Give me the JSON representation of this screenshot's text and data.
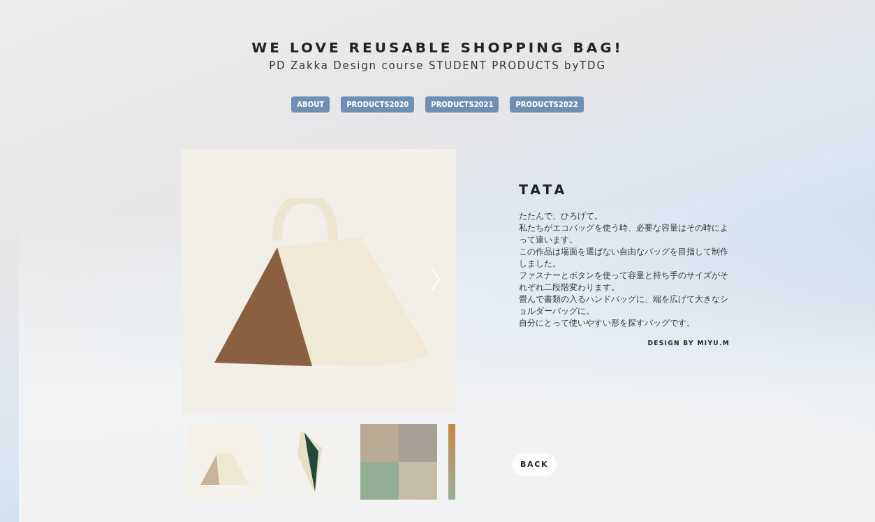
{
  "header": {
    "title": "WE LOVE REUSABLE SHOPPING BAG!",
    "subtitle": "PD Zakka Design course STUDENT PRODUCTS byTDG"
  },
  "nav": [
    {
      "label": "ABOUT"
    },
    {
      "label": "PRODUCTS2020"
    },
    {
      "label": "PRODUCTS2021"
    },
    {
      "label": "PRODUCTS2022"
    }
  ],
  "product": {
    "name": "TATA",
    "description": [
      "たたんで、ひろげて。",
      "私たちがエコバッグを使う時、必要な容量はその時によって違います。",
      "この作品は場面を選ばない自由なバッグを目指して制作しました。",
      "ファスナーとボタンを使って容量と持ち手のサイズがそれぞれ二段階変わります。",
      "畳んで書類の入るハンドバッグに、端を広げて大きなショルダーバッグに。",
      "自分にとって使いやすい形を探すバッグです。"
    ],
    "credit": "DESIGN BY MIYU.M"
  },
  "thumbnails": [
    {
      "kind": "bag-front"
    },
    {
      "kind": "bag-side"
    },
    {
      "kind": "collage"
    },
    {
      "kind": "partial"
    }
  ],
  "back_button": {
    "label": "BACK"
  }
}
